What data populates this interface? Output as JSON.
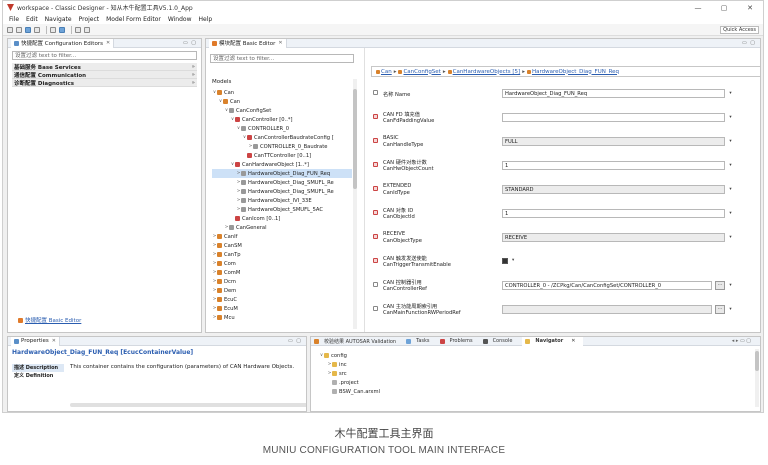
{
  "window": {
    "title": "workspace - Classic Designer - 知从木牛配置工具V5.1.0_App",
    "controls": {
      "minimize": "—",
      "maximize": "▢",
      "close": "✕"
    }
  },
  "menu": [
    "File",
    "Edit",
    "Navigate",
    "Project",
    "Model Form Editor",
    "Window",
    "Help"
  ],
  "toolbar": {
    "quick_access": "Quick Access"
  },
  "config_editors": {
    "tab_label": "快捷配置 Configuration Editors",
    "filter_placeholder": "设置过滤 text to filter...",
    "categories": [
      {
        "label": "基础服务 Base Services",
        "chev": "»"
      },
      {
        "label": "通信配置 Communication",
        "chev": "»"
      },
      {
        "label": "诊断配置 Diagnostics",
        "chev": "»"
      }
    ],
    "bottom_link": "快捷配置 Basic Editor"
  },
  "basic_editor": {
    "tab_label": "模块配置 Basic Editor",
    "filter_placeholder": "设置过滤 text to filter...",
    "models_label": "Models",
    "tree": [
      {
        "label": "Can",
        "indent": 0,
        "tw": "∨",
        "icon": "mod"
      },
      {
        "label": "Can",
        "indent": 1,
        "tw": "∨",
        "icon": "mod"
      },
      {
        "label": "CanConfigSet",
        "indent": 2,
        "tw": "∨",
        "icon": "leaf"
      },
      {
        "label": "CanController [0..*]",
        "indent": 3,
        "tw": "∨",
        "icon": "inst"
      },
      {
        "label": "CONTROLLER_0",
        "indent": 4,
        "tw": "∨",
        "icon": "leaf"
      },
      {
        "label": "CanControllerBaudrateConfig [",
        "indent": 5,
        "tw": "∨",
        "icon": "inst"
      },
      {
        "label": "CONTROLLER_0_Baudrate",
        "indent": 6,
        "tw": ">",
        "icon": "leaf"
      },
      {
        "label": "CanTTController [0..1]",
        "indent": 5,
        "tw": "",
        "icon": "inst"
      },
      {
        "label": "CanHardwareObject [1..*]",
        "indent": 3,
        "tw": "∨",
        "icon": "inst"
      },
      {
        "label": "HardwareObject_Diag_FUN_Req",
        "indent": 4,
        "tw": ">",
        "icon": "leaf",
        "selected": true
      },
      {
        "label": "HardwareObject_Diag_SMUFL_Re",
        "indent": 4,
        "tw": ">",
        "icon": "leaf"
      },
      {
        "label": "HardwareObject_Diag_SMUFL_Re",
        "indent": 4,
        "tw": ">",
        "icon": "leaf"
      },
      {
        "label": "HardwareObject_IVI_33E",
        "indent": 4,
        "tw": ">",
        "icon": "leaf"
      },
      {
        "label": "HardwareObject_SMUFL_5AC",
        "indent": 4,
        "tw": ">",
        "icon": "leaf"
      },
      {
        "label": "CanIcom [0..1]",
        "indent": 3,
        "tw": "",
        "icon": "inst"
      },
      {
        "label": "CanGeneral",
        "indent": 2,
        "tw": ">",
        "icon": "leaf"
      },
      {
        "label": "CanIf",
        "indent": 0,
        "tw": ">",
        "icon": "mod"
      },
      {
        "label": "CanSM",
        "indent": 0,
        "tw": ">",
        "icon": "mod"
      },
      {
        "label": "CanTp",
        "indent": 0,
        "tw": ">",
        "icon": "mod"
      },
      {
        "label": "Com",
        "indent": 0,
        "tw": ">",
        "icon": "mod"
      },
      {
        "label": "ComM",
        "indent": 0,
        "tw": ">",
        "icon": "mod"
      },
      {
        "label": "Dcm",
        "indent": 0,
        "tw": ">",
        "icon": "mod"
      },
      {
        "label": "Dem",
        "indent": 0,
        "tw": ">",
        "icon": "mod"
      },
      {
        "label": "EcuC",
        "indent": 0,
        "tw": ">",
        "icon": "mod"
      },
      {
        "label": "EcuM",
        "indent": 0,
        "tw": ">",
        "icon": "mod"
      },
      {
        "label": "Mcu",
        "indent": 0,
        "tw": ">",
        "icon": "mod"
      }
    ],
    "breadcrumb": [
      "Can",
      "CanConfigSet",
      "CanHardwareObjects [5]",
      "HardwareObject_Diag_FUN_Req"
    ],
    "breadcrumb_sep": "▸",
    "fields": [
      {
        "cn": "名称 Name",
        "en": "",
        "value": "HardwareObject_Diag_FUN_Req",
        "kind": "text",
        "icon": "plain"
      },
      {
        "cn": "CAN FD 填充值",
        "en": "CanFdPaddingValue",
        "value": "",
        "kind": "text",
        "icon": "red"
      },
      {
        "cn": "BASIC",
        "en": "CanHandleType",
        "value": "FULL",
        "kind": "select",
        "icon": "red"
      },
      {
        "cn": "CAN 硬件对象计数",
        "en": "CanHwObjectCount",
        "value": "1",
        "kind": "text",
        "icon": "red"
      },
      {
        "cn": "EXTENDED",
        "en": "CanIdType",
        "value": "STANDARD",
        "kind": "select",
        "icon": "red"
      },
      {
        "cn": "CAN 对象 ID",
        "en": "CanObjectId",
        "value": "1",
        "kind": "text",
        "icon": "red"
      },
      {
        "cn": "RECEIVE",
        "en": "CanObjectType",
        "value": "RECEIVE",
        "kind": "select",
        "icon": "red"
      },
      {
        "cn": "CAN 触发发送使能",
        "en": "CanTriggerTransmitEnable",
        "value": "",
        "kind": "check",
        "icon": "red"
      },
      {
        "cn": "CAN 控制器引用",
        "en": "CanControllerRef",
        "value": "CONTROLLER_0 - /ZCPkg/Can/CanConfigSet/CONTROLLER_0",
        "kind": "ref",
        "icon": "plain"
      },
      {
        "cn": "CAN 主功能周期索引用",
        "en": "CanMainFunctionRWPeriodRef",
        "value": "",
        "kind": "ref-disabled",
        "icon": "plain"
      }
    ],
    "drop_glyph": "▾",
    "ref_glyph": "⋯",
    "select_glyph": "▾"
  },
  "properties": {
    "tab_label": "Properties",
    "title": "HardwareObject_Diag_FUN_Req [EcucContainerValue]",
    "tabs": [
      "描述 Description",
      "定义 Definition"
    ],
    "description": "This container contains the configuration (parameters) of CAN Hardware Objects."
  },
  "bottom_tabs": [
    "校验结果 AUTOSAR Validation",
    "Tasks",
    "Problems",
    "Console",
    "Navigator"
  ],
  "navigator": [
    {
      "label": "config",
      "indent": 0,
      "tw": "∨",
      "icon": "folder"
    },
    {
      "label": "inc",
      "indent": 1,
      "tw": ">",
      "icon": "folder"
    },
    {
      "label": "src",
      "indent": 1,
      "tw": ">",
      "icon": "folder"
    },
    {
      "label": ".project",
      "indent": 1,
      "tw": "",
      "icon": "file"
    },
    {
      "label": "BSW_Can.arxml",
      "indent": 1,
      "tw": "",
      "icon": "file"
    }
  ],
  "caption": {
    "cn": "木牛配置工具主界面",
    "en": "MUNIU CONFIGURATION TOOL MAIN INTERFACE"
  }
}
